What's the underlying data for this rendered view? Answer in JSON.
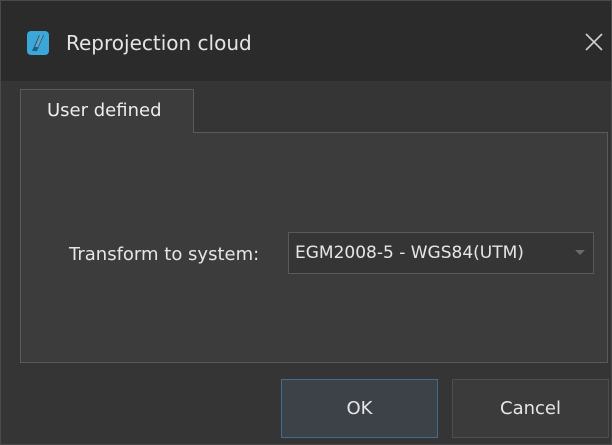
{
  "window": {
    "title": "Reprojection cloud",
    "app_icon": "app-logo-icon",
    "close_icon": "close-icon"
  },
  "tabs": [
    {
      "label": "User defined",
      "active": true
    }
  ],
  "form": {
    "transform_label": "Transform to system:",
    "transform_value": "EGM2008-5 - WGS84(UTM)",
    "dropdown_icon": "chevron-down-icon"
  },
  "buttons": {
    "ok_label": "OK",
    "cancel_label": "Cancel"
  },
  "colors": {
    "accent": "#3f6e92",
    "app_icon": "#3aa7d8",
    "background": "#353535",
    "panel": "#3c3c3c"
  }
}
